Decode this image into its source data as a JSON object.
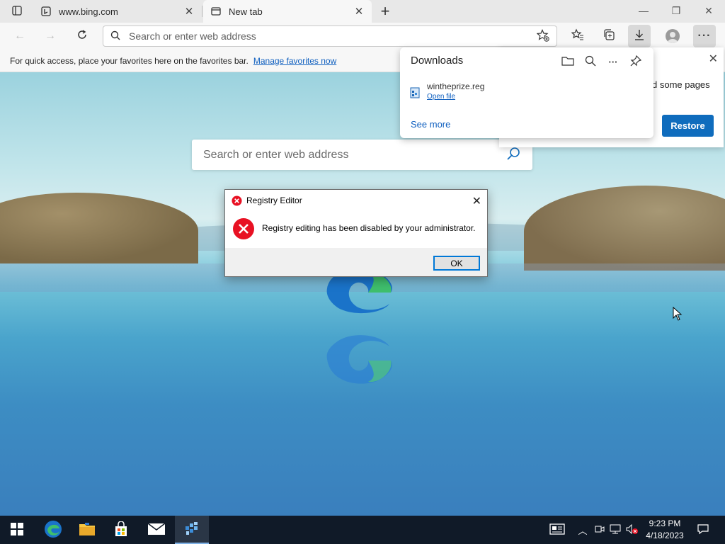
{
  "tabs": [
    {
      "title": "www.bing.com",
      "favicon": "bing-icon",
      "active": false
    },
    {
      "title": "New tab",
      "favicon": "newtab-page-icon",
      "active": true
    }
  ],
  "addressbar": {
    "placeholder": "Search or enter web address"
  },
  "favorites_bar": {
    "text": "For quick access, place your favorites here on the favorites bar.",
    "link": "Manage favorites now"
  },
  "ntp": {
    "search_placeholder": "Search or enter web address"
  },
  "restore_panel": {
    "text_fragment": "d some pages",
    "button": "Restore"
  },
  "downloads": {
    "header": "Downloads",
    "item": {
      "filename": "wintheprize.reg",
      "action": "Open file"
    },
    "see_more": "See more"
  },
  "dialog": {
    "title": "Registry Editor",
    "message": "Registry editing has been disabled by your administrator.",
    "ok": "OK"
  },
  "taskbar": {
    "apps": [
      "start-icon",
      "edge-icon",
      "file-explorer-icon",
      "store-icon",
      "mail-icon",
      "regedit-icon"
    ],
    "clock": {
      "time": "9:23 PM",
      "date": "4/18/2023"
    }
  },
  "colors": {
    "accent": "#0f6cbd",
    "link": "#0f5fbf",
    "error": "#e81123",
    "taskbar": "#101a28"
  }
}
